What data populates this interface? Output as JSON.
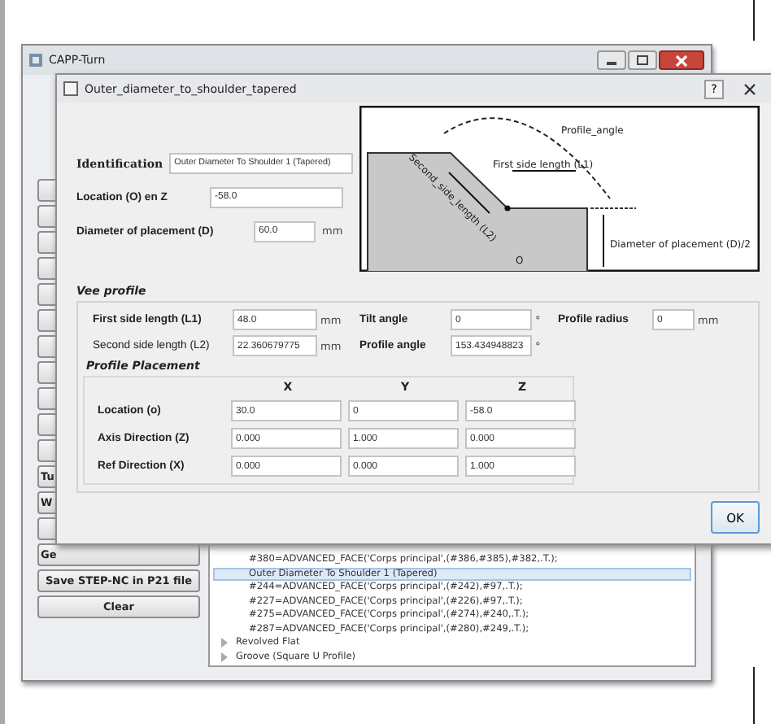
{
  "main_window": {
    "title": "CAPP-Turn",
    "side_buttons": [
      {
        "kind": "blank"
      },
      {
        "kind": "blank"
      },
      {
        "kind": "blank"
      },
      {
        "kind": "blank"
      },
      {
        "kind": "blank"
      },
      {
        "kind": "blank"
      },
      {
        "kind": "blank"
      },
      {
        "kind": "blank"
      },
      {
        "kind": "blank"
      },
      {
        "kind": "blank"
      },
      {
        "kind": "blank"
      },
      {
        "kind": "labeled",
        "label": "Tu"
      },
      {
        "kind": "labeled",
        "label": "W"
      },
      {
        "kind": "blank"
      },
      {
        "kind": "labeled",
        "label": "Ge"
      }
    ],
    "save_button": "Save STEP-NC in P21 file",
    "clear_button": "Clear",
    "tree_rows": [
      {
        "text": "#380=ADVANCED_FACE('Corps principal',(#386,#385),#382,.T.);",
        "selected": false
      },
      {
        "text": "Outer Diameter To Shoulder 1 (Tapered)",
        "selected": true
      },
      {
        "text": "#244=ADVANCED_FACE('Corps principal',(#242),#97,.T.);",
        "selected": false
      },
      {
        "text": "#227=ADVANCED_FACE('Corps principal',(#226),#97,.T.);",
        "selected": false
      },
      {
        "text": "#275=ADVANCED_FACE('Corps principal',(#274),#240,.T.);",
        "selected": false
      },
      {
        "text": "#287=ADVANCED_FACE('Corps principal',(#280),#249,.T.);",
        "selected": false
      }
    ],
    "tree_nodes": [
      {
        "text": "Revolved Flat",
        "expanded": false
      },
      {
        "text": "Groove (Square U Profile)",
        "expanded": false
      }
    ]
  },
  "dialog": {
    "title": "Outer_diameter_to_shoulder_tapered",
    "help_button": "?",
    "identification": {
      "label": "Identification",
      "value": "Outer Diameter To Shoulder 1 (Tapered)"
    },
    "location": {
      "label": "Location (O) en Z",
      "value": "-58.0"
    },
    "diameter": {
      "label": "Diameter of placement (D)",
      "value": "60.0",
      "unit": "mm"
    },
    "diagram": {
      "angle_label": "Profile_angle",
      "first_label": "First side length (L1)",
      "second_label": "Second_side_length (L2)",
      "diameter_label": "Diameter of placement (D)/2",
      "origin_label": "O"
    },
    "vee_profile": {
      "title": "Vee profile",
      "rows": [
        [
          {
            "label": "First side length (L1)",
            "value": "48.0",
            "unit": "mm"
          },
          {
            "label": "Tilt angle",
            "value": "0",
            "unit": "°"
          },
          {
            "label": "Profile radius",
            "value": "0",
            "unit": "mm"
          }
        ],
        [
          {
            "label": "Second side length (L2)",
            "value": "22.360679775",
            "unit": "mm"
          },
          {
            "label": "Profile angle",
            "value": "153.434948823",
            "unit": "°"
          }
        ]
      ]
    },
    "placement": {
      "title": "Profile Placement",
      "columns": [
        "X",
        "Y",
        "Z"
      ],
      "rows": [
        {
          "label": "Location (o)",
          "values": [
            "30.0",
            "0",
            "-58.0"
          ]
        },
        {
          "label": "Axis Direction (Z)",
          "values": [
            "0.000",
            "1.000",
            "0.000"
          ]
        },
        {
          "label": "Ref Direction (X)",
          "values": [
            "0.000",
            "0.000",
            "1.000"
          ]
        }
      ]
    },
    "ok_button": "OK"
  }
}
